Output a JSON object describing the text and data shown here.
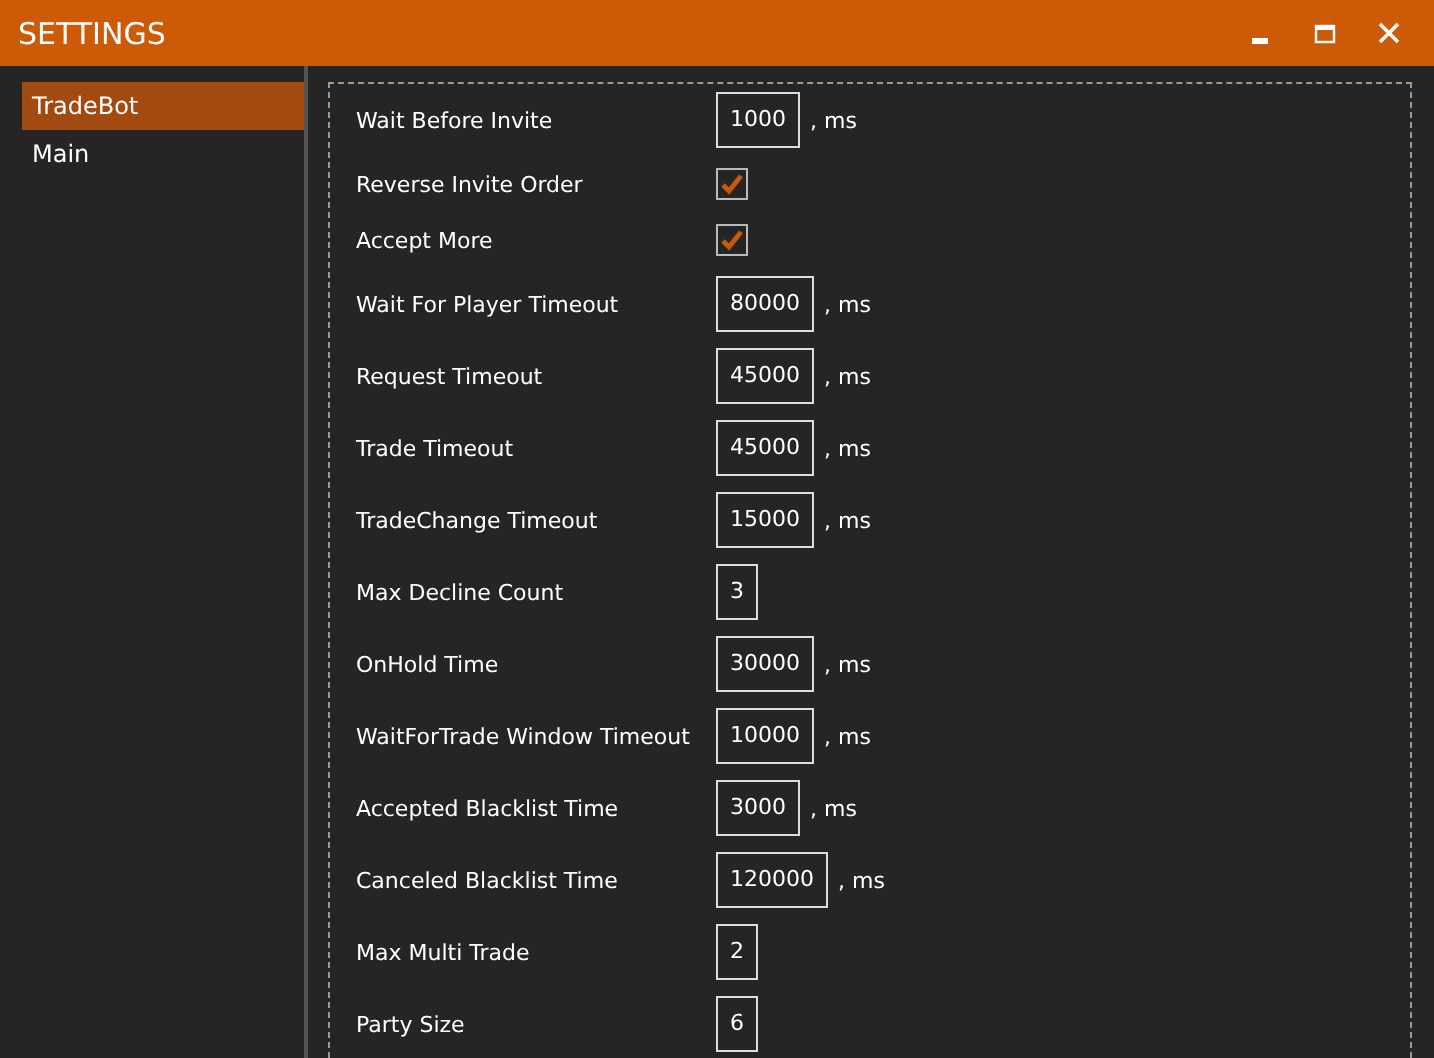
{
  "window": {
    "title": "SETTINGS"
  },
  "sidebar": {
    "items": [
      {
        "label": "TradeBot",
        "selected": true
      },
      {
        "label": "Main",
        "selected": false
      }
    ]
  },
  "settings": [
    {
      "kind": "number",
      "label": "Wait Before Invite",
      "value": "1000",
      "unit": ", ms"
    },
    {
      "kind": "checkbox",
      "label": "Reverse Invite Order",
      "checked": true
    },
    {
      "kind": "checkbox",
      "label": "Accept More",
      "checked": true
    },
    {
      "kind": "number",
      "label": "Wait For Player Timeout",
      "value": "80000",
      "unit": ", ms"
    },
    {
      "kind": "number",
      "label": "Request Timeout",
      "value": "45000",
      "unit": ", ms"
    },
    {
      "kind": "number",
      "label": "Trade Timeout",
      "value": "45000",
      "unit": ", ms"
    },
    {
      "kind": "number",
      "label": "TradeChange Timeout",
      "value": "15000",
      "unit": ", ms"
    },
    {
      "kind": "number",
      "label": "Max Decline Count",
      "value": "3"
    },
    {
      "kind": "number",
      "label": "OnHold Time",
      "value": "30000",
      "unit": ", ms"
    },
    {
      "kind": "number",
      "label": "WaitForTrade Window Timeout",
      "value": "10000",
      "unit": ", ms"
    },
    {
      "kind": "number",
      "label": "Accepted Blacklist Time",
      "value": "3000",
      "unit": ", ms"
    },
    {
      "kind": "number",
      "label": "Canceled Blacklist Time",
      "value": "120000",
      "unit": ", ms"
    },
    {
      "kind": "number",
      "label": "Max Multi Trade",
      "value": "2"
    },
    {
      "kind": "number",
      "label": "Party Size",
      "value": "6"
    }
  ]
}
